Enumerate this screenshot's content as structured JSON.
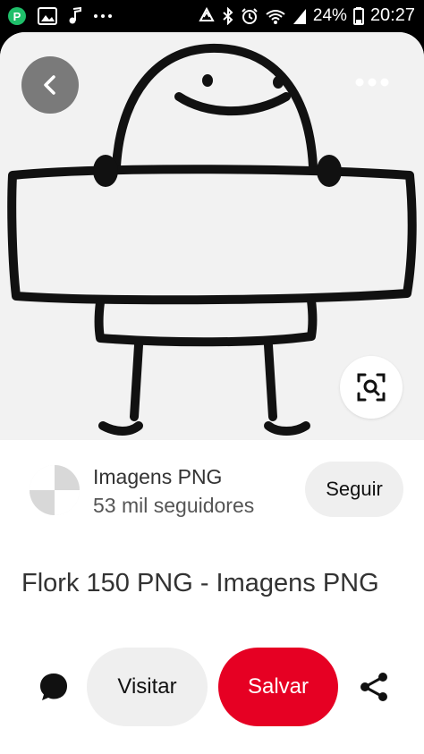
{
  "status_bar": {
    "battery_percent": "24%",
    "time": "20:27",
    "left_icons": [
      "app-p-icon",
      "image-icon",
      "music-note-icon",
      "more-dots-icon"
    ],
    "right_icons": [
      "recycle-icon",
      "bluetooth-icon",
      "alarm-icon",
      "wifi-icon",
      "signal-icon",
      "battery-icon"
    ]
  },
  "pin": {
    "image_description_icons": [
      "back-arrow-icon",
      "more-options-icon",
      "visual-search-icon"
    ]
  },
  "creator": {
    "name": "Imagens PNG",
    "followers": "53 mil seguidores",
    "follow_label": "Seguir"
  },
  "title": "Flork 150 PNG - Imagens PNG",
  "actions": {
    "visit_label": "Visitar",
    "save_label": "Salvar",
    "save_color": "#e60023"
  },
  "colors": {
    "card_bg": "#ffffff",
    "pill_bg": "#efefef",
    "status_bg": "#000000"
  }
}
